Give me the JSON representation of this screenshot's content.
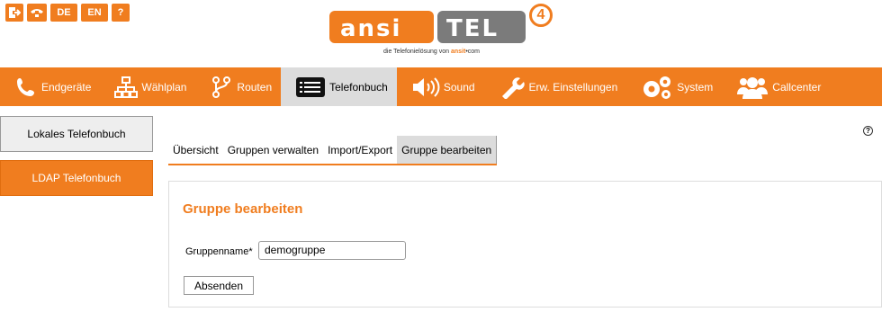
{
  "top_icons": [
    {
      "name": "logout-icon",
      "label": ""
    },
    {
      "name": "phone-hangup-icon",
      "label": ""
    },
    {
      "name": "lang-de-flag",
      "label": "DE"
    },
    {
      "name": "lang-en-flag",
      "label": "EN"
    },
    {
      "name": "help-icon",
      "label": "?"
    }
  ],
  "logo": {
    "left_text": "ansi",
    "right_text": "TEL",
    "version": "4",
    "tagline_pre": "die Telefonielösung von ",
    "tagline_brand": "ansit",
    "tagline_post": "•com"
  },
  "nav": [
    {
      "label": "Endgeräte",
      "icon": "phone-icon"
    },
    {
      "label": "Wählplan",
      "icon": "sitemap-icon"
    },
    {
      "label": "Routen",
      "icon": "route-icon"
    },
    {
      "label": "Telefonbuch",
      "icon": "list-icon",
      "active": true
    },
    {
      "label": "Sound",
      "icon": "speaker-icon"
    },
    {
      "label": "Erw. Einstellungen",
      "icon": "wrench-icon"
    },
    {
      "label": "System",
      "icon": "gears-icon"
    },
    {
      "label": "Callcenter",
      "icon": "users-icon"
    }
  ],
  "sidebar": [
    {
      "label": "Lokales Telefonbuch"
    },
    {
      "label": "LDAP Telefonbuch"
    }
  ],
  "tabs": [
    {
      "label": "Übersicht"
    },
    {
      "label": "Gruppen verwalten"
    },
    {
      "label": "Import/Export"
    },
    {
      "label": "Gruppe bearbeiten",
      "active": true
    }
  ],
  "form": {
    "title": "Gruppe bearbeiten",
    "group_name_label": "Gruppenname*",
    "group_name_value": "demogruppe",
    "submit_label": "Absenden"
  },
  "help_label": "?",
  "colors": {
    "accent": "#f07d1f",
    "active_bg": "#dcdcdc",
    "logo_gray": "#7b7b7b"
  }
}
